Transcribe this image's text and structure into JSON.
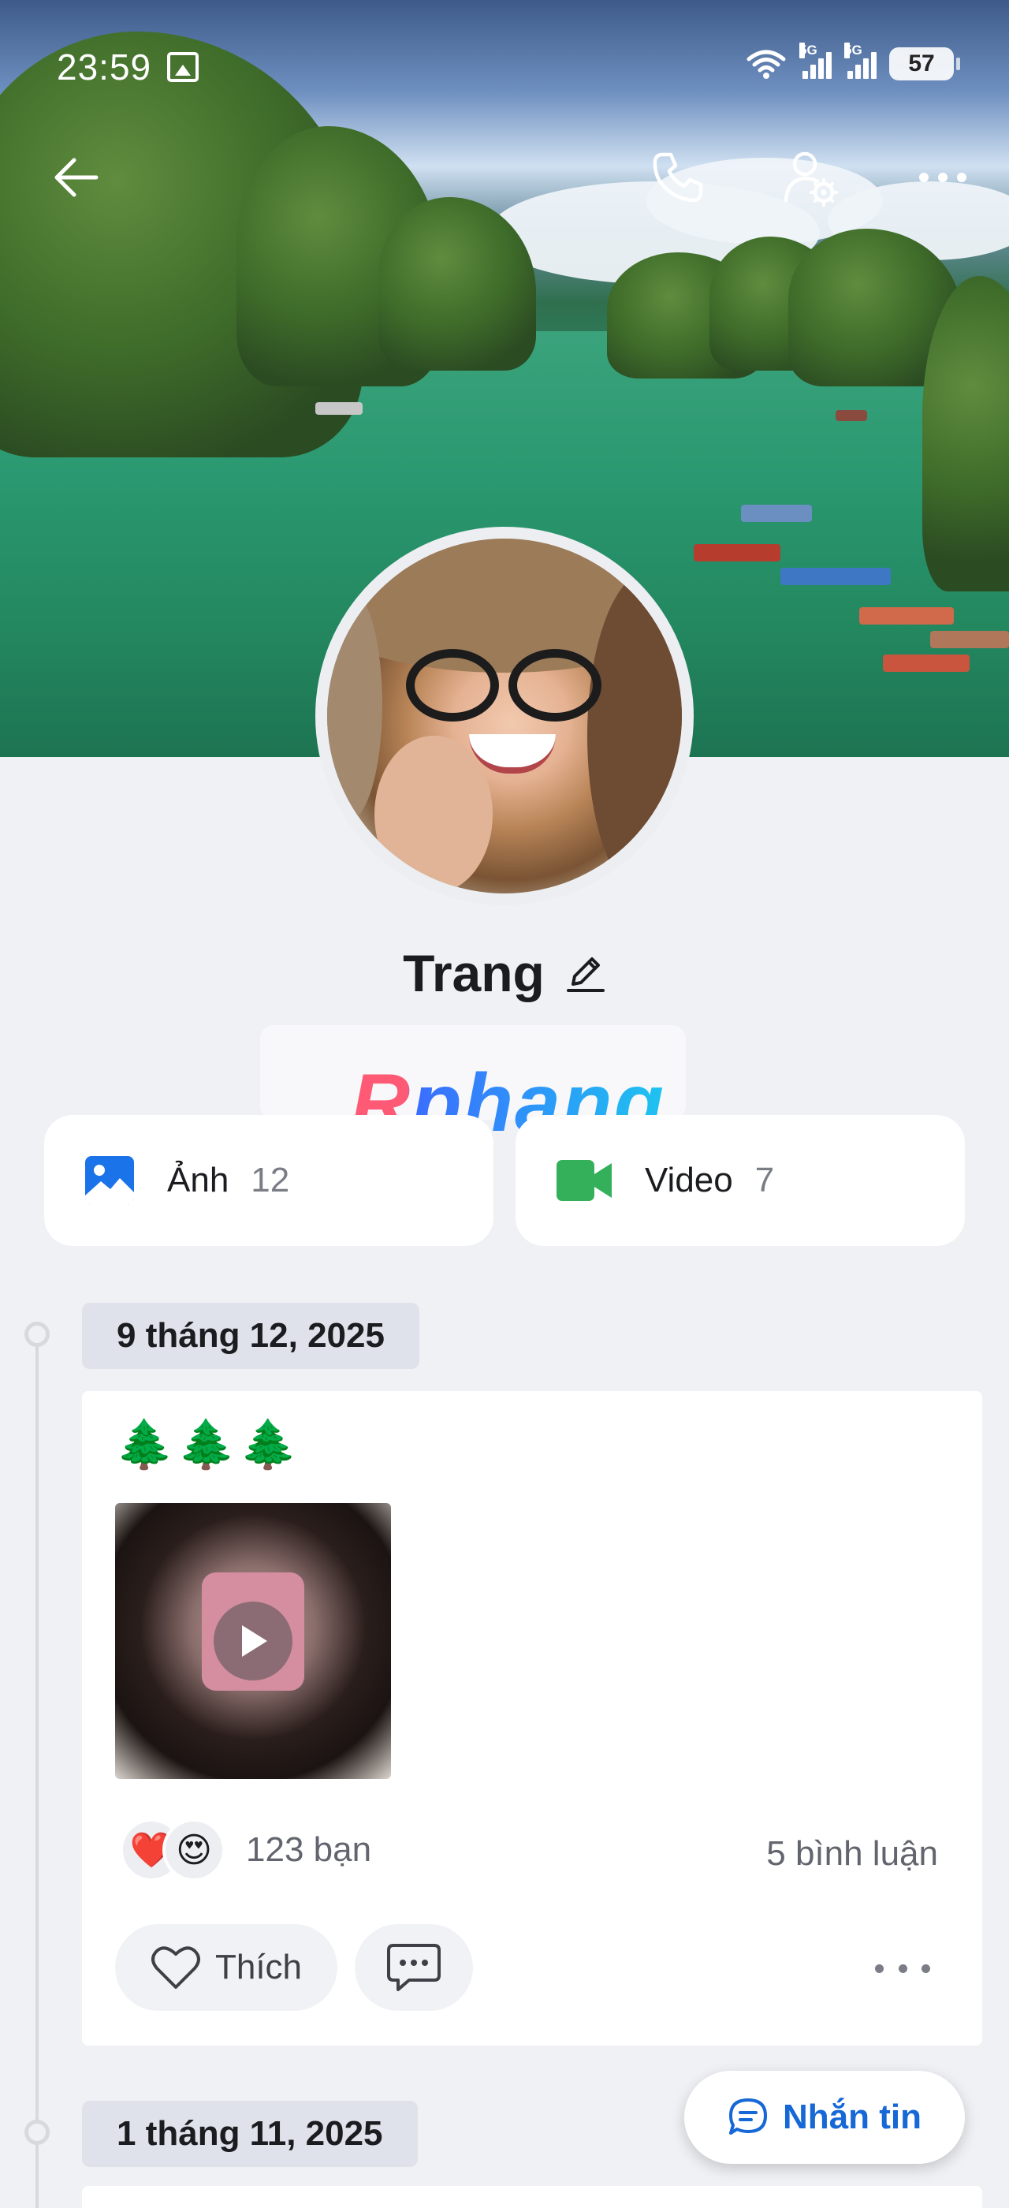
{
  "status_bar": {
    "time": "23:59",
    "network_1": "5G",
    "network_2": "5G",
    "battery": "57"
  },
  "profile": {
    "name": "Trang"
  },
  "watermark": {
    "text": "Rphang"
  },
  "media": {
    "photos": {
      "label": "Ảnh",
      "count": "12",
      "icon": "image-icon",
      "color": "#1a73e8"
    },
    "videos": {
      "label": "Video",
      "count": "7",
      "icon": "video-camera-icon",
      "color": "#34b05a"
    }
  },
  "timeline": [
    {
      "date": "9 tháng 12, 2025",
      "post": {
        "text": "🌲🌲🌲",
        "reaction_emojis": [
          "❤️",
          "😍"
        ],
        "reaction_count": "123 bạn",
        "comment_count": "5 bình luận",
        "like_label": "Thích"
      }
    },
    {
      "date": "1 tháng 11, 2025"
    }
  ],
  "fab": {
    "label": "Nhắn tin"
  },
  "colors": {
    "accent": "#1568d6",
    "background": "#f0f1f5"
  }
}
